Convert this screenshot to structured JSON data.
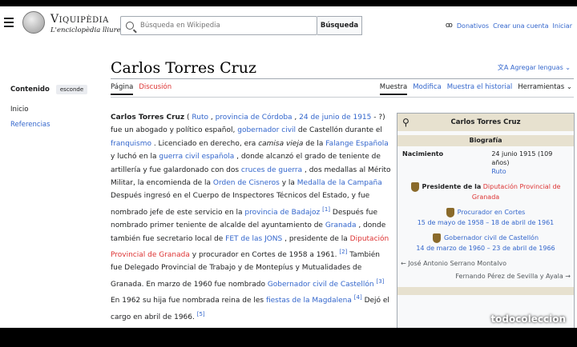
{
  "header": {
    "brand_title": "Viquipèdia",
    "brand_subtitle": "L'enciclopèdia lliure",
    "search_placeholder": "Búsqueda en Wikipedia",
    "search_button": "Búsqueda",
    "links": [
      "Donativos",
      "Crear una cuenta",
      "Iniciar"
    ]
  },
  "sidebar": {
    "heading": "Contenido",
    "hide": "esconde",
    "items": [
      "Inicio",
      "Referencias"
    ]
  },
  "title": "Carlos Torres Cruz",
  "lang_button": "Agregar lenguas",
  "tabs_left": [
    "Página",
    "Discusión"
  ],
  "tabs_right": [
    "Muestra",
    "Modifica",
    "Muestra el historial",
    "Herramientas"
  ],
  "body": {
    "p1_a": "Carlos Torres Cruz",
    "p1_b": " ( ",
    "l_ruto": "Ruto",
    "p1_c": " , ",
    "l_prov": "provincia de Córdoba",
    "p1_d": " , ",
    "l_date": "24 de junio de 1915",
    "p1_e": " - ?) fue un abogado y político español, ",
    "l_gob": "gobernador civil",
    "p1_f": " de Castellón durante el ",
    "l_fra": "franquismo",
    "p1_g": " . Licenciado en derecho, era ",
    "i_cam": "camisa vieja",
    "p1_h": " de la ",
    "l_fal": "Falange Española",
    "p1_i": " y luchó en la ",
    "l_gue": "guerra civil española",
    "p1_j": " , donde alcanzó el grado de teniente de artillería y fue galardonado con dos ",
    "l_cru": "cruces de guerra",
    "p1_k": " , dos medallas al Mérito Militar, la encomienda de la ",
    "l_cis": "Orden de Cisneros",
    "p1_l": " y la ",
    "l_med": "Medalla de la Campaña",
    "p1_m": " Después ingresó en el Cuerpo de Inspectores Técnicos del Estado, y fue nombrado jefe de este servicio en la ",
    "l_bad": "provincia de Badajoz",
    "s1": "[1]",
    "p1_n": " Después fue nombrado primer teniente de alcalde del ayuntamiento de ",
    "l_gra": "Granada",
    "p1_o": " , donde también fue secretario local de ",
    "l_fet": "FET de las JONS",
    "p1_p": " , presidente de la ",
    "l_dip": "Diputación Provincial de Granada",
    "p1_q": " y procurador en Cortes de 1958 a 1961.",
    "s2": "[2]",
    "p1_r": " También fue Delegado Provincial de Trabajo y de Montepíus y Mutualidades de Granada. En marzo de 1960 fue nombrado ",
    "l_gcc": "Gobernador civil de Castellón",
    "s3": "[3]",
    "p1_s": " En 1962 su hija fue nombrada reina de les ",
    "l_fie": "fiestas de la Magdalena",
    "s4": "[4]",
    "p1_t": " Dejó el cargo en abril de 1966.",
    "s5": "[5]"
  },
  "infobox": {
    "title": "Carlos Torres Cruz",
    "section": "Biografía",
    "birth_label": "Nacimiento",
    "birth_value": "24 junio 1915 (109 años)",
    "birth_place": "Ruto",
    "pos1_prefix": "Presidente de la",
    "pos1_link": "Diputación Provincial de Granada",
    "pos2": "Procurador en Cortes",
    "pos2_dates": "15 de mayo de 1958 – 18 de abril de 1961",
    "pos3": "Gobernador civil de Castellón",
    "pos3_dates": "14 de marzo de 1960 – 23 de abril de 1966",
    "pred": "← José Antonio Serrano Montalvo",
    "succ": "Fernando Pérez de Sevilla y Ayala →"
  },
  "watermark": "todocoleccion"
}
